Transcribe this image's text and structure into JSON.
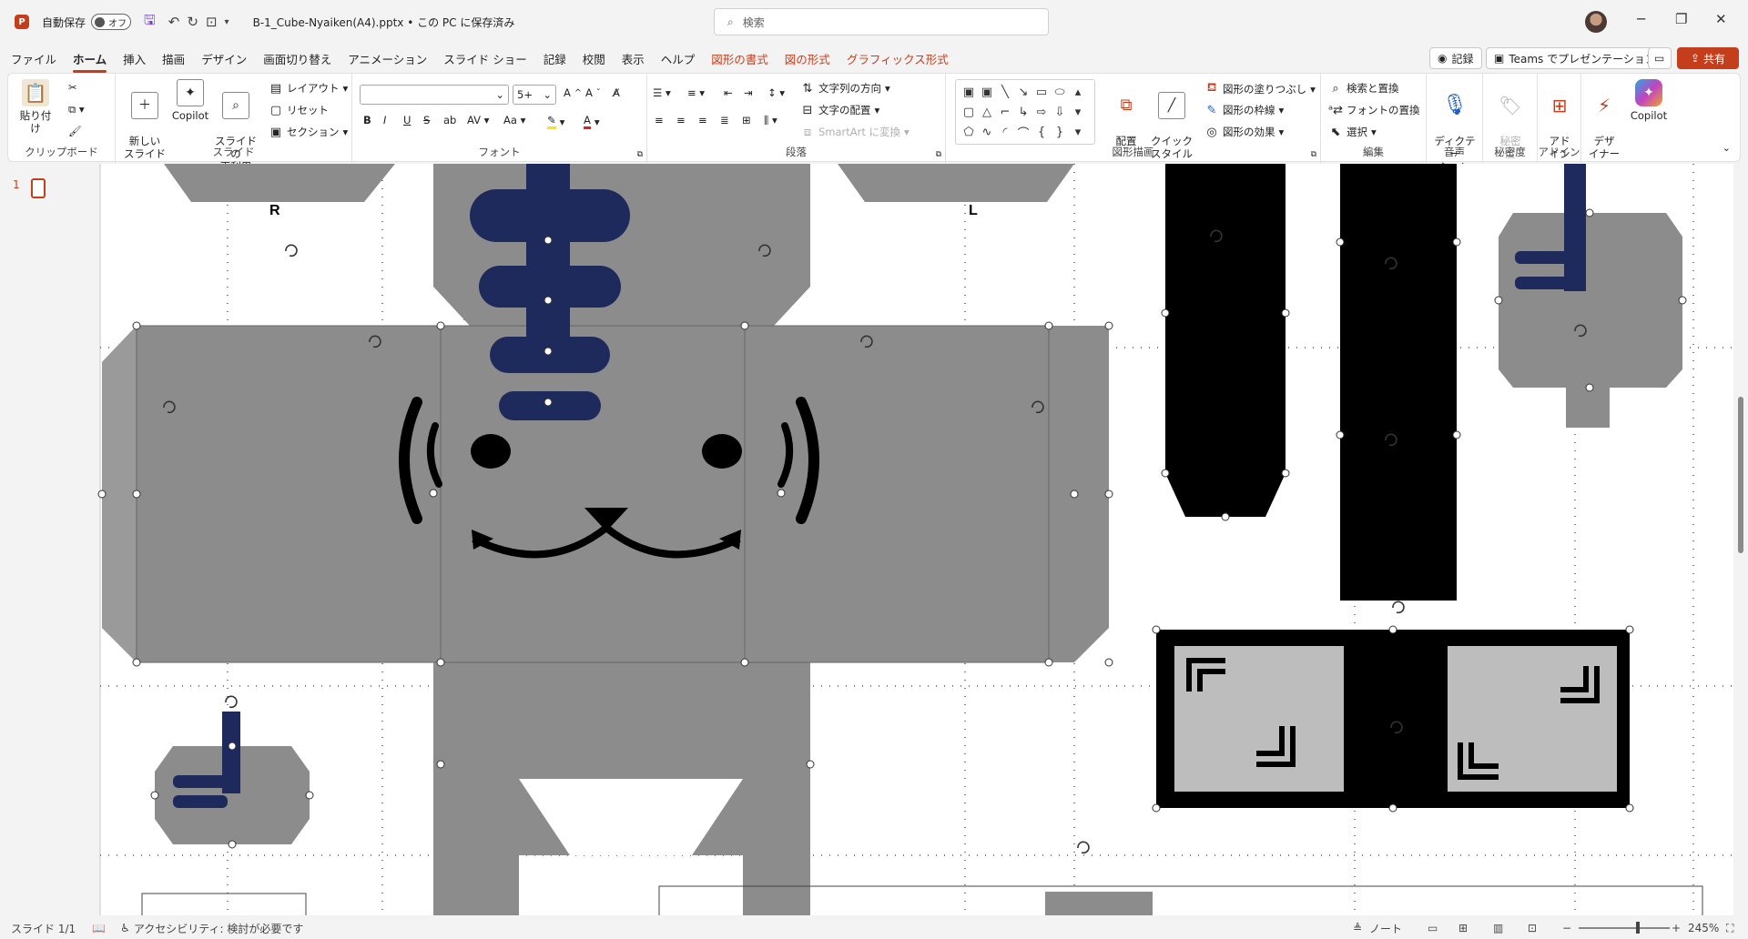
{
  "titlebar": {
    "app_logo": "P",
    "autosave_label": "自動保存",
    "autosave_state": "オフ",
    "doc_title": "B-1_Cube-Nyaiken(A4).pptx • この PC に保存済み",
    "search_placeholder": "検索"
  },
  "menu": {
    "tabs": [
      "ファイル",
      "ホーム",
      "挿入",
      "描画",
      "デザイン",
      "画面切り替え",
      "アニメーション",
      "スライド ショー",
      "記録",
      "校閲",
      "表示",
      "ヘルプ"
    ],
    "contextual_tabs": [
      "図形の書式",
      "図の形式",
      "グラフィックス形式"
    ],
    "active_tab": "ホーム",
    "record_button": "記録",
    "teams_button": "Teams でプレゼンテーション",
    "share_button": "共有"
  },
  "ribbon": {
    "clipboard": {
      "paste": "貼り付け",
      "label": "クリップボード"
    },
    "slides": {
      "new_slide": "新しい\nスライド",
      "copilot": "Copilot",
      "reuse": "スライドの\n再利用",
      "layout": "レイアウト",
      "reset": "リセット",
      "section": "セクション",
      "label": "スライド"
    },
    "font": {
      "font_name": "",
      "font_size": "5+",
      "label": "フォント"
    },
    "paragraph": {
      "text_direction": "文字列の方向",
      "align_text": "文字の配置",
      "smartart": "SmartArt に変換",
      "label": "段落"
    },
    "drawing": {
      "arrange": "配置",
      "quick_styles": "クイック\nスタイル",
      "shape_fill": "図形の塗りつぶし",
      "shape_outline": "図形の枠線",
      "shape_effects": "図形の効果",
      "label": "図形描画"
    },
    "editing": {
      "find": "検索と置換",
      "replace_fonts": "フォントの置換",
      "select": "選択",
      "label": "編集"
    },
    "voice": {
      "dictate": "ディクテー\nション",
      "label": "音声"
    },
    "sensitivity": {
      "button": "秘密\n度",
      "label": "秘密度"
    },
    "addins": {
      "addins": "アド\nイン",
      "designer": "デザ\nイナー",
      "copilot": "Copilot",
      "label": "アドイン"
    }
  },
  "slides_pane": {
    "slide_number": "1"
  },
  "canvas": {
    "left_label": "R",
    "right_label": "L"
  },
  "status": {
    "slide_info": "スライド 1/1",
    "accessibility": "アクセシビリティ: 検討が必要です",
    "notes": "ノート",
    "zoom": "245%",
    "zoom_fraction": 0.65
  },
  "colors": {
    "accent": "#c43e1c",
    "navy": "#1f2a5c",
    "gray_fill": "#8c8c8c",
    "light_gray": "#bdbdbd"
  }
}
